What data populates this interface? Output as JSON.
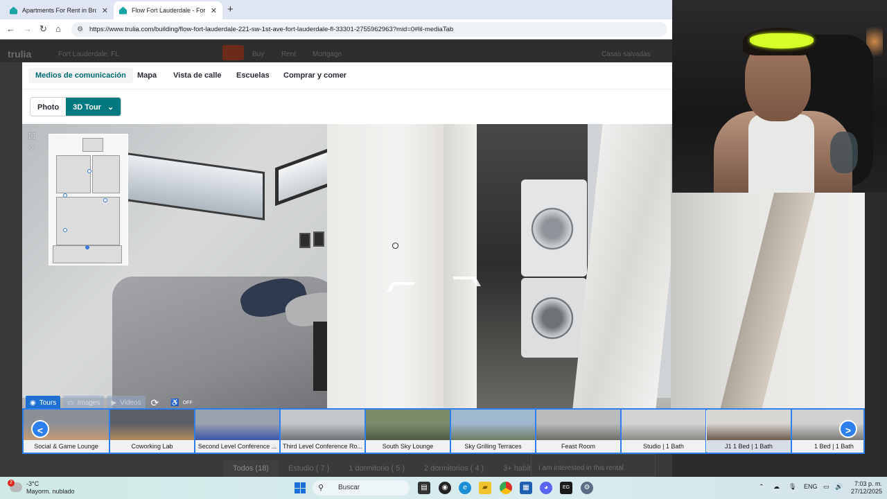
{
  "browser": {
    "tabs": [
      {
        "title": "Apartments For Rent in Browar",
        "active": false
      },
      {
        "title": "Flow Fort Lauderdale - Fort Lau",
        "active": true
      }
    ],
    "new_tab": "+",
    "url": "https://www.trulia.com/building/flow-fort-lauderdale-221-sw-1st-ave-fort-lauderdale-fl-33301-2755962963?mid=0#lil-mediaTab"
  },
  "site_header": {
    "logo": "trulia",
    "location": "Fort Lauderdale, FL",
    "links": [
      "Buy",
      "Rent",
      "Mortgage"
    ],
    "saved_homes": "Casas salvadas"
  },
  "modal": {
    "tabs": [
      "Medios de comunicación",
      "Mapa",
      "Vista de calle",
      "Escuelas",
      "Comprar y comer"
    ],
    "active_tab": 0,
    "view_toggle": {
      "photo": "Photo",
      "tour": "3D Tour",
      "tour_caret": "⌄"
    }
  },
  "viewer": {
    "media_buttons": [
      {
        "label": "Tours",
        "icon": "360-icon",
        "state": "on"
      },
      {
        "label": "Images",
        "icon": "image-icon",
        "state": "dim"
      },
      {
        "label": "Videos",
        "icon": "video-icon",
        "state": "dim"
      }
    ],
    "autorotate_label": "",
    "accessibility_label": "OFF"
  },
  "thumbnails": [
    {
      "label": "Social & Game Lounge",
      "colors": [
        "#8b8f96",
        "#c49a74"
      ]
    },
    {
      "label": "Coworking Lab",
      "colors": [
        "#5a5e66",
        "#b18a5c"
      ]
    },
    {
      "label": "Second Level Conference ...",
      "colors": [
        "#9aa3ad",
        "#3b56a8"
      ]
    },
    {
      "label": "Third Level Conference Ro...",
      "colors": [
        "#c3c7cc",
        "#6f7278"
      ]
    },
    {
      "label": "South Sky Lounge",
      "colors": [
        "#7b8c6a",
        "#4f5b45"
      ]
    },
    {
      "label": "Sky Grilling Terraces",
      "colors": [
        "#9fb7cf",
        "#6f7b62"
      ]
    },
    {
      "label": "Feast Room",
      "colors": [
        "#b9bbbd",
        "#6d6a66"
      ]
    },
    {
      "label": "Studio | 1 Bath",
      "colors": [
        "#d2d3d4",
        "#8d8a86"
      ]
    },
    {
      "label": "J1 1 Bed | 1 Bath",
      "colors": [
        "#d8d6d3",
        "#6e5a4a"
      ],
      "selected": true
    },
    {
      "label": "1 Bed | 1 Bath",
      "colors": [
        "#cfd0d2",
        "#7d7a76"
      ]
    }
  ],
  "filters": [
    "Todos (18)",
    "Estudio ( 7 )",
    "1 dormitorio ( 5 )",
    "2 dormitorios ( 4 )",
    "3+ habit."
  ],
  "message_preview": "I am interested in this rental",
  "taskbar": {
    "weather_temp": "-3°C",
    "weather_desc": "Mayorm. nublado",
    "weather_badge": "2",
    "search_placeholder": "Buscar",
    "lang": "ENG",
    "time": "7:03 p. m.",
    "date": "27/12/2025"
  }
}
